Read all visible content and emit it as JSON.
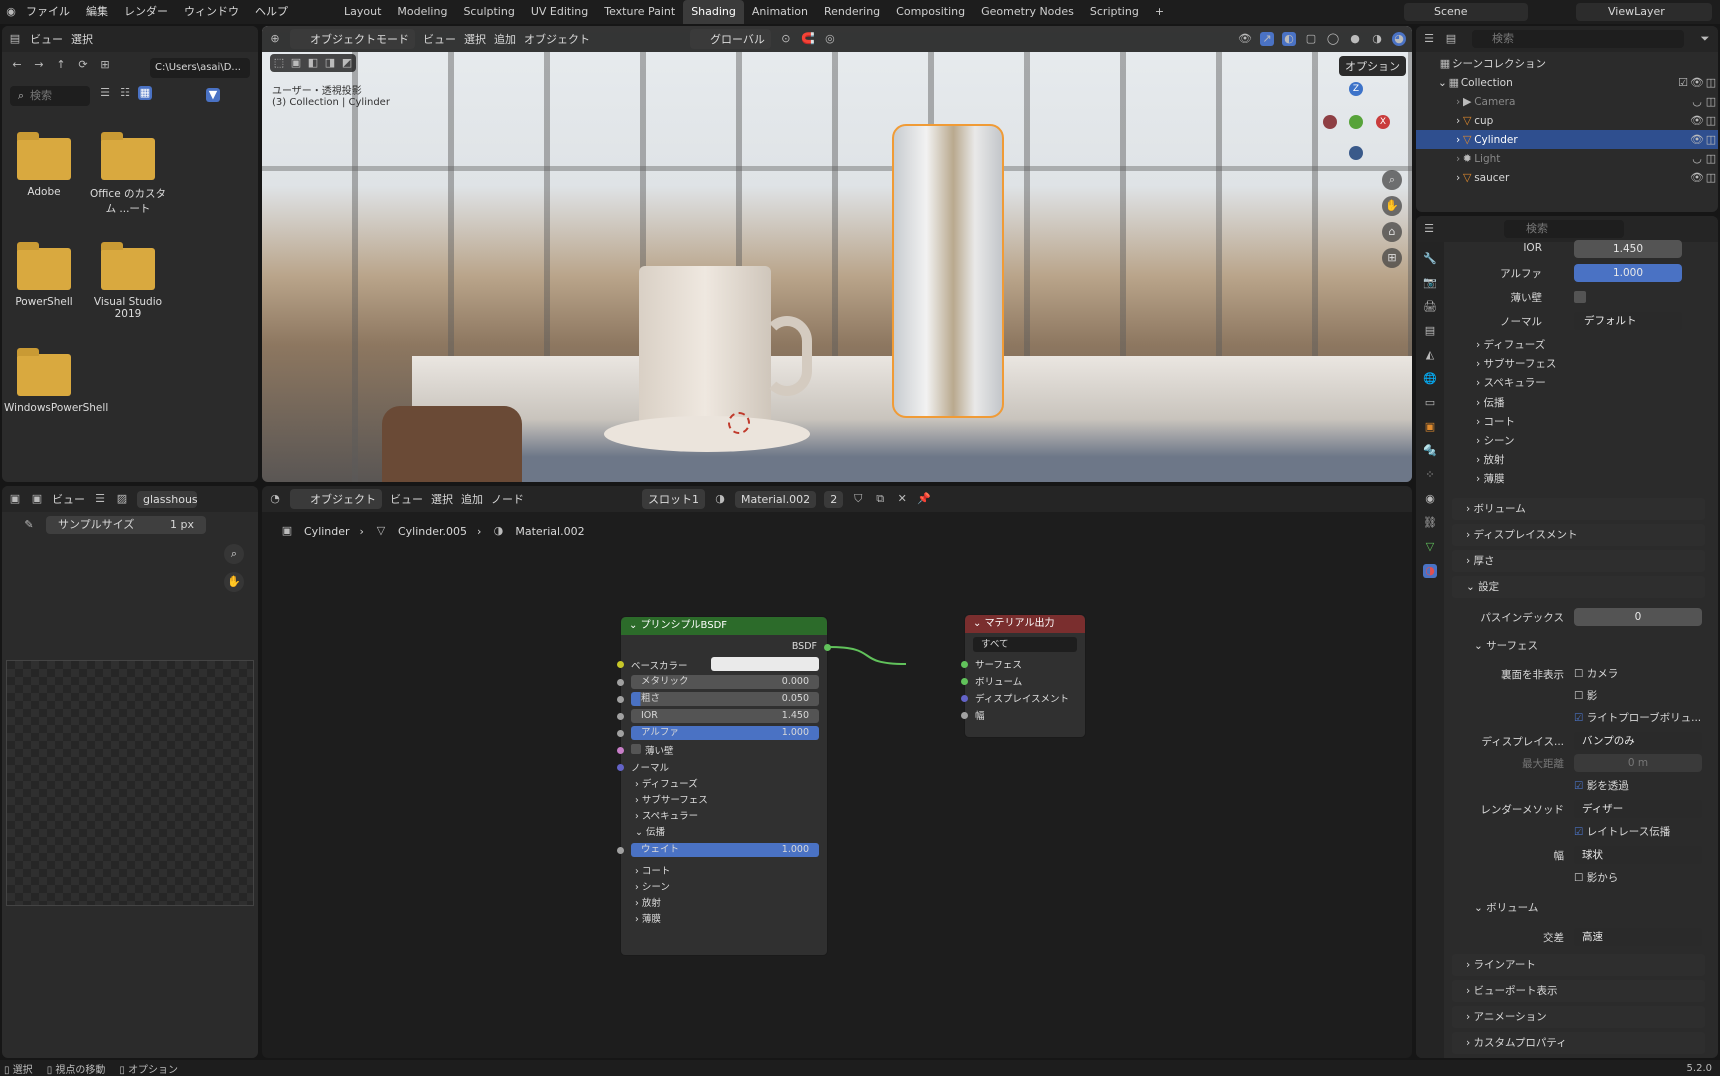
{
  "topbar": {
    "menus": [
      "ファイル",
      "編集",
      "レンダー",
      "ウィンドウ",
      "ヘルプ"
    ],
    "workspaces": [
      "Layout",
      "Modeling",
      "Sculpting",
      "UV Editing",
      "Texture Paint",
      "Shading",
      "Animation",
      "Rendering",
      "Compositing",
      "Geometry Nodes",
      "Scripting"
    ],
    "active_workspace": "Shading",
    "scene": "Scene",
    "view_layer": "ViewLayer"
  },
  "filebrowser": {
    "menu_view": "ビュー",
    "menu_select": "選択",
    "path": "C:\\Users\\asai\\D...",
    "search_placeholder": "検索",
    "folders": [
      "Adobe",
      "Office のカスタム ...ート",
      "PowerShell",
      "Visual Studio 2019",
      "WindowsPowerShell"
    ]
  },
  "viewport": {
    "mode": "オブジェクトモード",
    "menus": [
      "ビュー",
      "選択",
      "追加",
      "オブジェクト"
    ],
    "orientation": "グローバル",
    "options": "オプション",
    "overlay_line1": "ユーザー・透視投影",
    "overlay_line2": "(3) Collection | Cylinder",
    "gizmo_z": "Z",
    "gizmo_x": "X"
  },
  "image_editor": {
    "menu_view": "ビュー",
    "image_name": "glasshous",
    "sample_label": "サンプルサイズ",
    "sample_value": "1 px"
  },
  "node_editor": {
    "mode": "オブジェクト",
    "menus": [
      "ビュー",
      "選択",
      "追加",
      "ノード"
    ],
    "slot": "スロット1",
    "material": "Material.002",
    "users": "2",
    "breadcrumb": [
      "Cylinder",
      "Cylinder.005",
      "Material.002"
    ],
    "bsdf": {
      "title": "プリンシプルBSDF",
      "output": "BSDF",
      "base_color": "ベースカラー",
      "metallic_label": "メタリック",
      "metallic": "0.000",
      "roughness_label": "粗さ",
      "roughness": "0.050",
      "ior_label": "IOR",
      "ior": "1.450",
      "alpha_label": "アルファ",
      "alpha": "1.000",
      "thin": "薄い壁",
      "normal": "ノーマル",
      "diffuse": "ディフューズ",
      "subsurface": "サブサーフェス",
      "specular": "スペキュラー",
      "transmission": "伝播",
      "weight_label": "ウェイト",
      "weight": "1.000",
      "coat": "コート",
      "sheen": "シーン",
      "emission": "放射",
      "thinfilm": "薄膜"
    },
    "output": {
      "title": "マテリアル出力",
      "target": "すべて",
      "surface": "サーフェス",
      "volume": "ボリューム",
      "displacement": "ディスプレイスメント",
      "thickness": "幅"
    }
  },
  "outliner": {
    "title": "シーンコレクション",
    "collection": "Collection",
    "items": [
      "Camera",
      "cup",
      "Cylinder",
      "Light",
      "saucer"
    ]
  },
  "properties": {
    "search_placeholder": "検索",
    "ior_label": "IOR",
    "ior": "1.450",
    "alpha_label": "アルファ",
    "alpha": "1.000",
    "thin_label": "薄い壁",
    "normal_label": "ノーマル",
    "normal": "デフォルト",
    "subs": [
      "ディフューズ",
      "サブサーフェス",
      "スペキュラー",
      "伝播",
      "コート",
      "シーン",
      "放射",
      "薄膜"
    ],
    "volume": "ボリューム",
    "displacement": "ディスプレイスメント",
    "thickness": "厚さ",
    "settings": "設定",
    "pass_label": "パスインデックス",
    "pass": "0",
    "surface": "サーフェス",
    "backface_label": "裏面を非表示",
    "camera": "カメラ",
    "shadow": "影",
    "lightprobe": "ライトプローブボリュ...",
    "disp_label": "ディスプレイス...",
    "disp_value": "バンプのみ",
    "maxdist_label": "最大距離",
    "maxdist": "0 m",
    "transparent_shadow": "影を透過",
    "render_label": "レンダーメソッド",
    "render_value": "ディザー",
    "raytrace": "レイトレース伝播",
    "width_label": "幅",
    "width_value": "球状",
    "from_shadow": "影から",
    "vol2": "ボリューム",
    "intersect_label": "交差",
    "intersect_value": "高速",
    "lineart": "ラインアート",
    "viewport_display": "ビューポート表示",
    "animation": "アニメーション",
    "custom_props": "カスタムプロパティ"
  },
  "statusbar": {
    "select": "選択",
    "move": "視点の移動",
    "options": "オプション",
    "version": "5.2.0"
  },
  "colors": {
    "bsdf_header": "#2c6b2a",
    "output_header": "#7a2e2e",
    "accent": "#4a72c4",
    "selection": "#2f4f8f"
  }
}
